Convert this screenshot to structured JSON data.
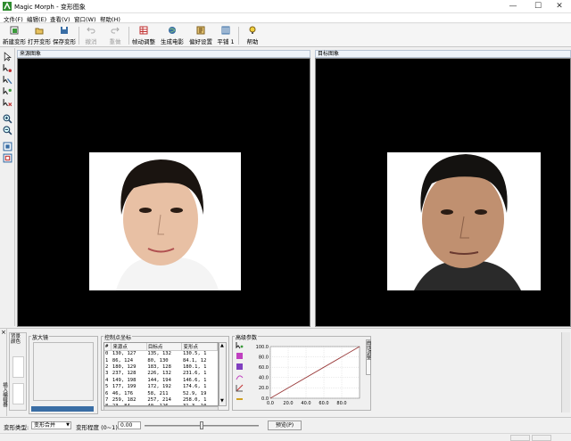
{
  "window": {
    "title": "Magic Morph - 变形图象",
    "minimize": "—",
    "maximize": "☐",
    "close": "✕"
  },
  "menu": {
    "items": [
      "文件(F)",
      "编辑(E)",
      "查看(V)",
      "窗口(W)",
      "帮助(H)"
    ]
  },
  "toolbar": {
    "new_label": "新建变形",
    "open_label": "打开变形",
    "save_label": "保存变形",
    "undo_label": "撤消",
    "redo_label": "重做",
    "frame_adjust_label": "帧动调整",
    "make_movie_label": "生成电影",
    "prefs_label": "偏好设置",
    "tile_label": "平铺 1",
    "help_label": "帮助"
  },
  "panes": {
    "source_title": "来源图象",
    "target_title": "目标图象"
  },
  "bottom": {
    "side_tab_1": "背景颜色",
    "side_tab_2": "插入编辑器",
    "zoom_title": "放大镜",
    "control_title": "控制点坐标",
    "advanced_title": "高级参数",
    "table_headers": [
      "#",
      "来源点",
      "目标点",
      "变形点"
    ],
    "table_rows": [
      [
        "0",
        "130, 127",
        "135, 132",
        "130.5, 1"
      ],
      [
        "1",
        "86, 124",
        "80, 130",
        "84.1, 12"
      ],
      [
        "2",
        "180, 129",
        "183, 128",
        "180.1, 1"
      ],
      [
        "3",
        "237, 128",
        "226, 132",
        "231.6, 1"
      ],
      [
        "4",
        "149, 198",
        "144, 194",
        "146.6, 1"
      ],
      [
        "5",
        "177, 199",
        "172, 192",
        "174.6, 1"
      ],
      [
        "6",
        "46, 176",
        "58, 211",
        "52.9, 19"
      ],
      [
        "7",
        "259, 182",
        "257, 214",
        "258.0, 1"
      ],
      [
        "8",
        "23, 84",
        "40, 126",
        "31.3, 10"
      ]
    ],
    "y_ticks": [
      "100.0",
      "80.0",
      "60.0",
      "40.0",
      "20.0",
      "0.0"
    ],
    "x_ticks": [
      "0.0",
      "20.0",
      "40.0",
      "60.0",
      "80.0"
    ],
    "right_vertical_label": "曲线/调整"
  },
  "chart_data": {
    "type": "line",
    "title": "",
    "xlabel": "",
    "ylabel": "",
    "xlim": [
      0,
      100
    ],
    "ylim": [
      0,
      100
    ],
    "grid": true,
    "series": [
      {
        "x": [
          0,
          100
        ],
        "y": [
          0,
          100
        ]
      }
    ]
  },
  "status": {
    "type_label": "变形类型:",
    "type_value": "变形合并",
    "degree_label": "变形程度 (0~1)",
    "degree_value": "0.00",
    "slider_position": 0.5,
    "preview_button": "预览(P)"
  },
  "colors": {
    "curve": "#9a3b3b",
    "toolbar_icon_blue": "#3a6ea5",
    "toolbar_icon_green": "#3a9a3a"
  }
}
